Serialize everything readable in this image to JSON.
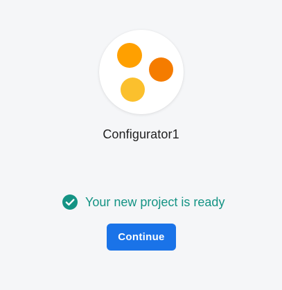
{
  "project": {
    "name": "Configurator1",
    "logo": {
      "icon": "three-dots-logo-icon",
      "colors": [
        "#ffa000",
        "#f57c00",
        "#fbc02d"
      ]
    }
  },
  "status": {
    "icon": "check-circle-icon",
    "message": "Your new project is ready",
    "color": "#149384"
  },
  "actions": {
    "continue_label": "Continue",
    "accent": "#1a73e8"
  }
}
